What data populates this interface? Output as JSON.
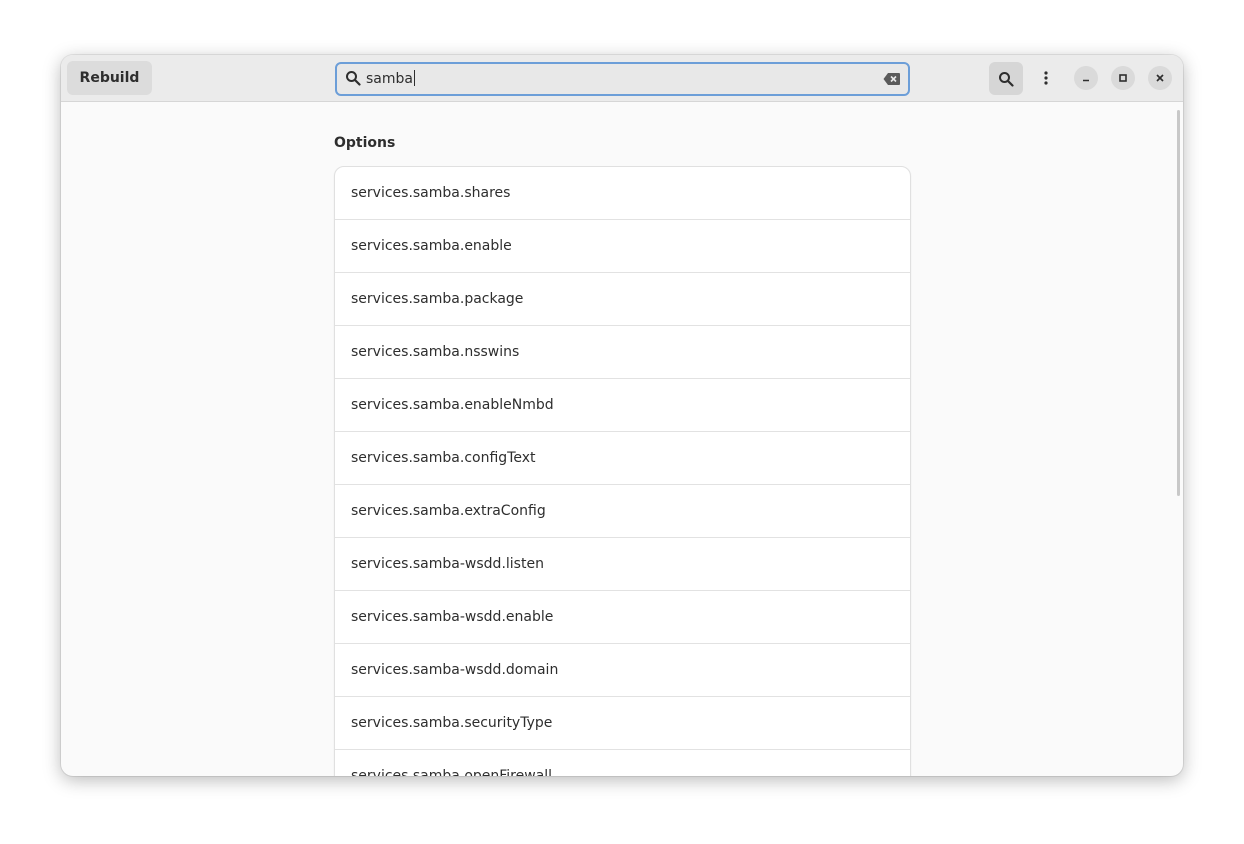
{
  "header": {
    "rebuild_label": "Rebuild",
    "search": {
      "value": "samba"
    }
  },
  "main": {
    "section_title": "Options",
    "options": [
      "services.samba.shares",
      "services.samba.enable",
      "services.samba.package",
      "services.samba.nsswins",
      "services.samba.enableNmbd",
      "services.samba.configText",
      "services.samba.extraConfig",
      "services.samba-wsdd.listen",
      "services.samba-wsdd.enable",
      "services.samba-wsdd.domain",
      "services.samba.securityType",
      "services.samba.openFirewall"
    ]
  },
  "icons": {
    "search_field": "search-icon",
    "clear": "clear-text-icon",
    "search_toggle": "search-icon",
    "menu": "kebab-menu-icon",
    "minimize": "minimize-icon",
    "maximize": "maximize-icon",
    "close": "close-icon"
  }
}
